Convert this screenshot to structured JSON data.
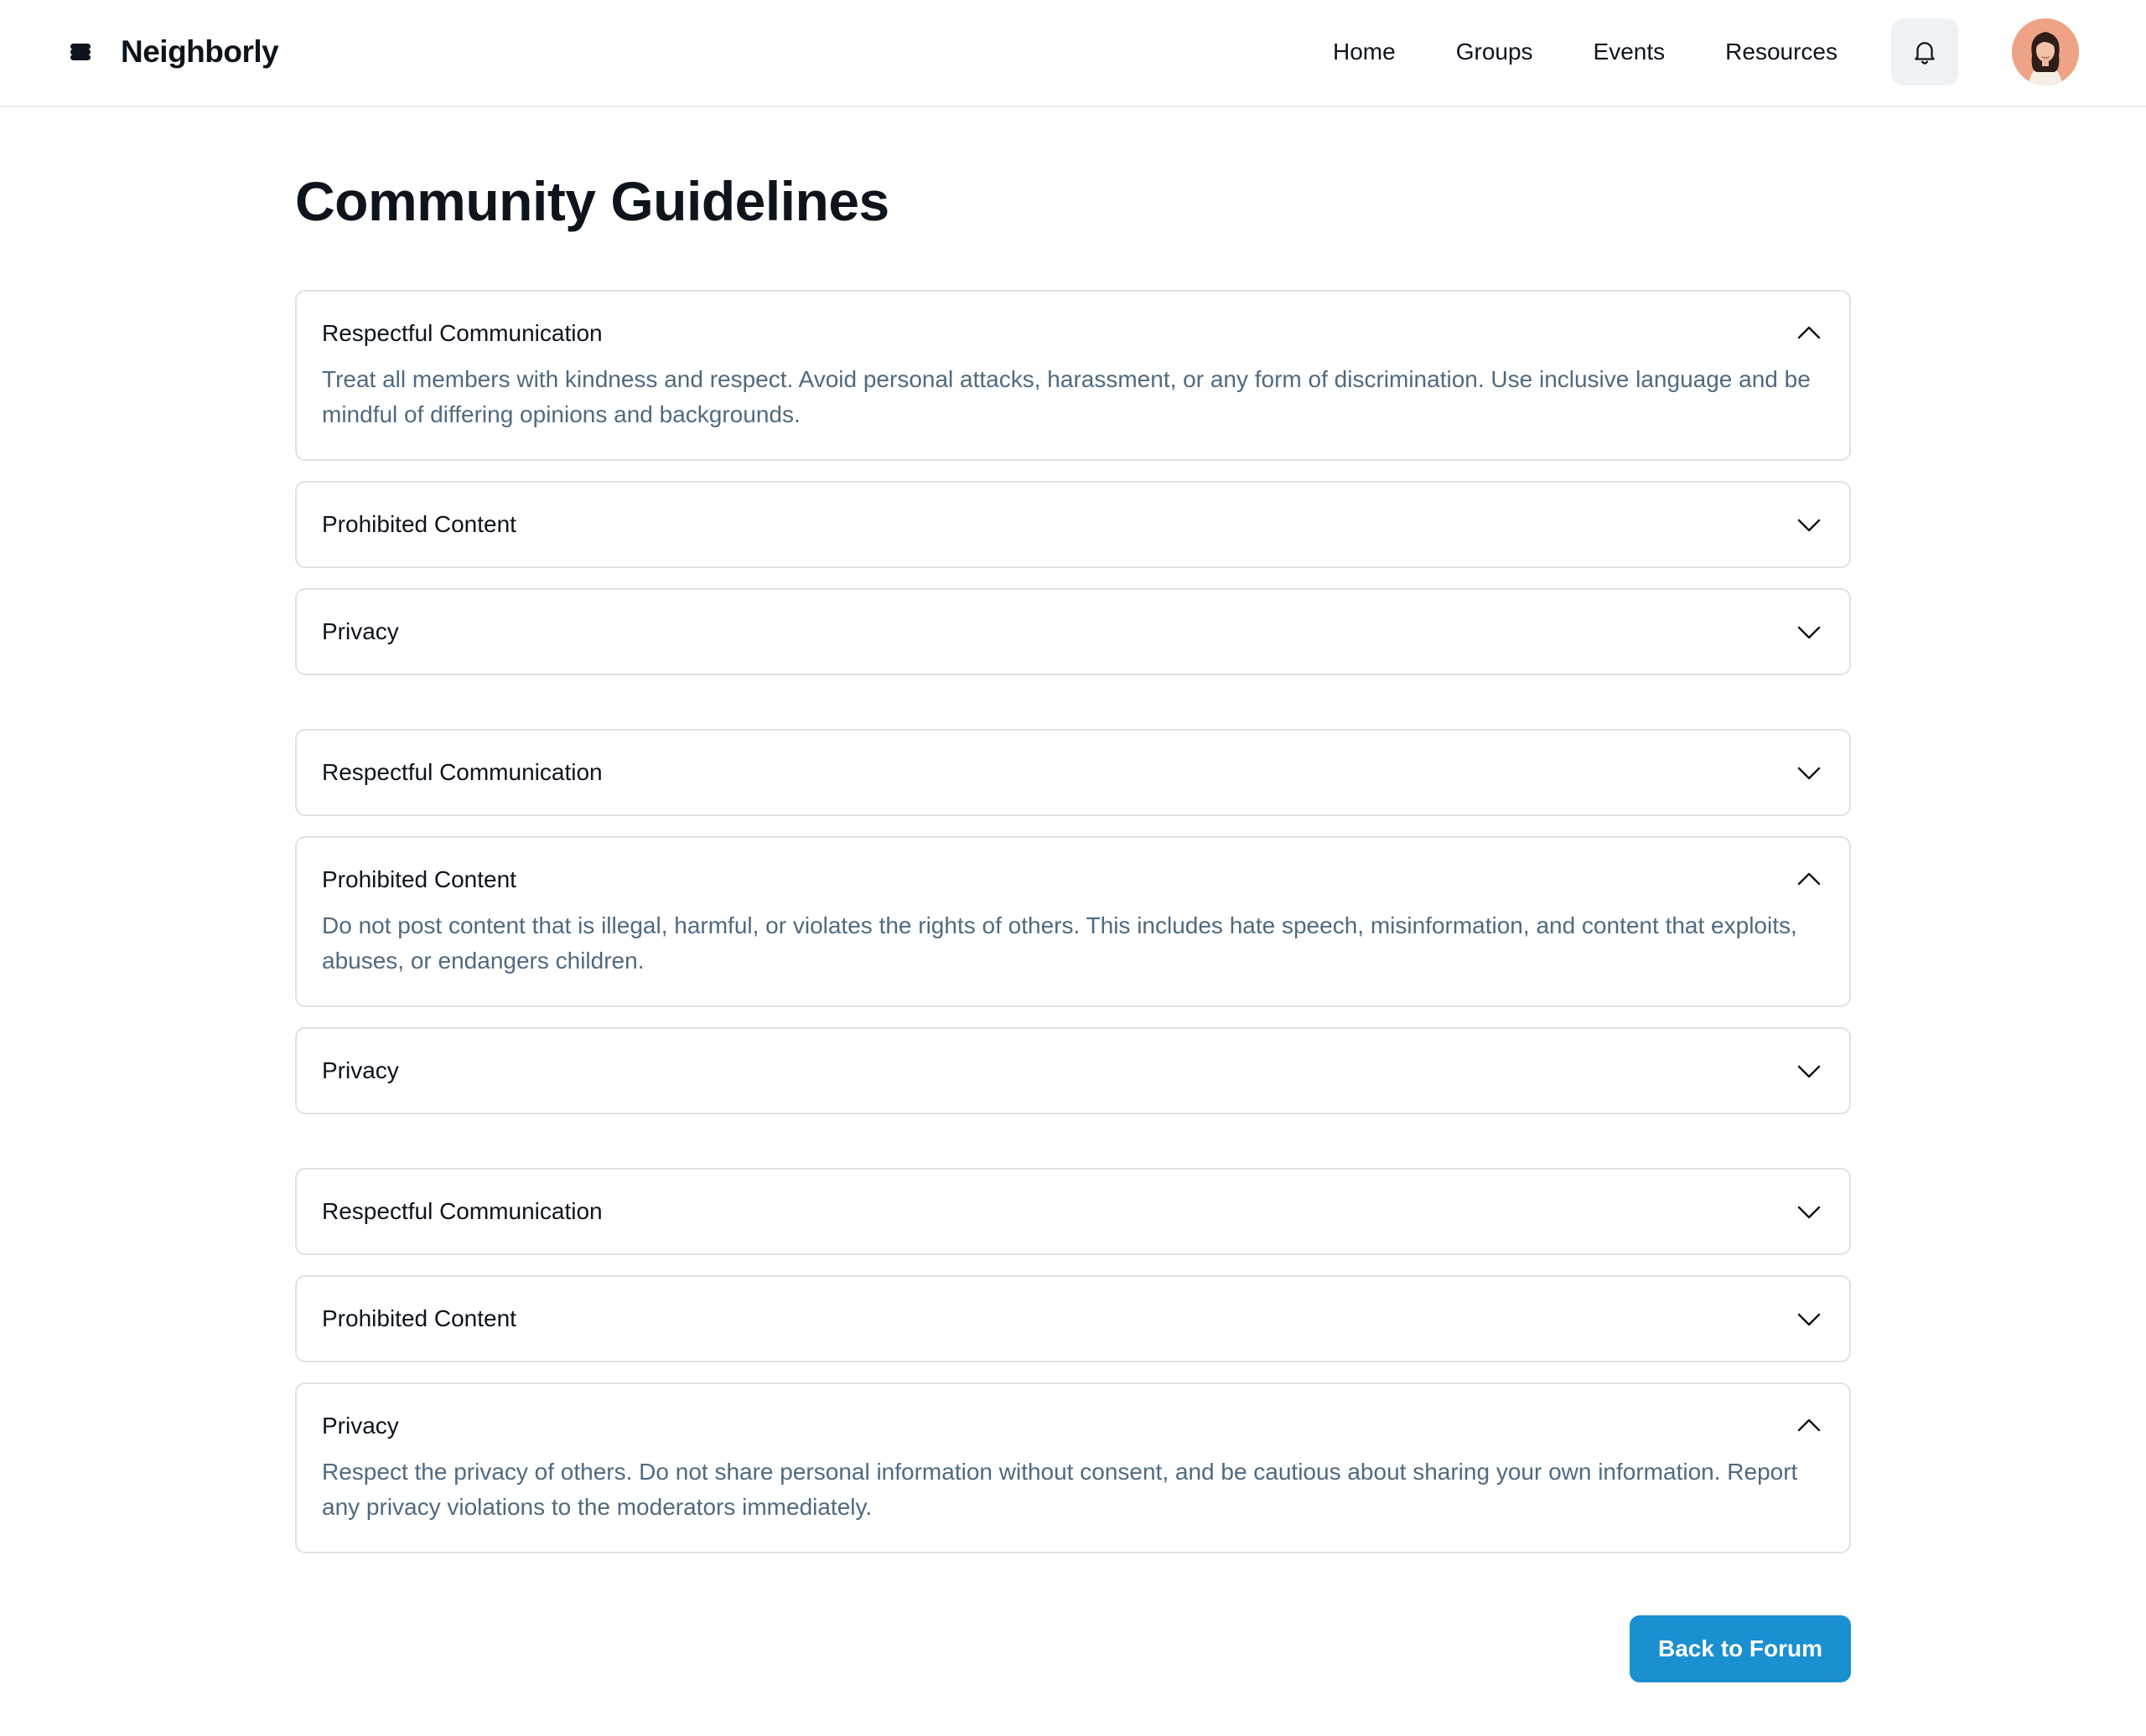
{
  "header": {
    "brand_name": "Neighborly",
    "nav": [
      "Home",
      "Groups",
      "Events",
      "Resources"
    ]
  },
  "page": {
    "title": "Community Guidelines"
  },
  "groups": [
    {
      "items": [
        {
          "title": "Respectful Communication",
          "open": true,
          "body": "Treat all members with kindness and respect. Avoid personal attacks, harassment, or any form of discrimination. Use inclusive language and be mindful of differing opinions and backgrounds."
        },
        {
          "title": "Prohibited Content",
          "open": false,
          "body": ""
        },
        {
          "title": "Privacy",
          "open": false,
          "body": ""
        }
      ]
    },
    {
      "items": [
        {
          "title": "Respectful Communication",
          "open": false,
          "body": ""
        },
        {
          "title": "Prohibited Content",
          "open": true,
          "body": "Do not post content that is illegal, harmful, or violates the rights of others. This includes hate speech, misinformation, and content that exploits, abuses, or endangers children."
        },
        {
          "title": "Privacy",
          "open": false,
          "body": ""
        }
      ]
    },
    {
      "items": [
        {
          "title": "Respectful Communication",
          "open": false,
          "body": ""
        },
        {
          "title": "Prohibited Content",
          "open": false,
          "body": ""
        },
        {
          "title": "Privacy",
          "open": true,
          "body": "Respect the privacy of others. Do not share personal information without consent, and be cautious about sharing your own information. Report any privacy violations to the moderators immediately."
        }
      ]
    }
  ],
  "footer": {
    "back_label": "Back to Forum"
  },
  "icons": {
    "logo": "logo-icon",
    "bell": "bell-icon",
    "expand": "chevron-down-icon",
    "collapse": "chevron-up-icon"
  },
  "colors": {
    "accent": "#1a90d0",
    "body_text": "#4f6a80",
    "border": "#dde3e8"
  }
}
